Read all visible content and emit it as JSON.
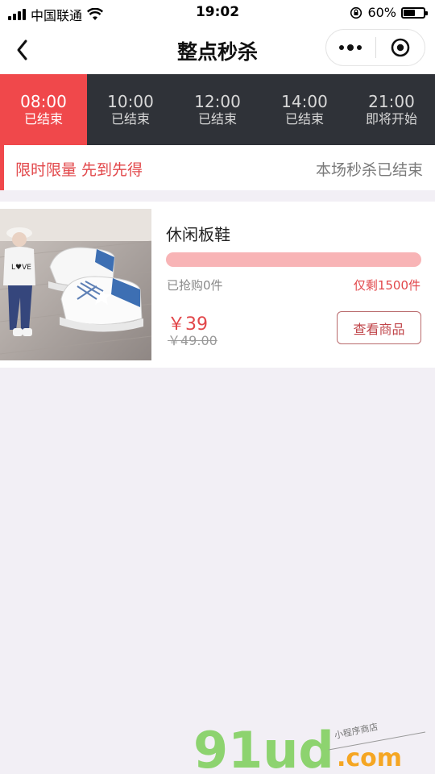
{
  "status_bar": {
    "carrier": "中国联通",
    "time": "19:02",
    "battery_percent": "60%",
    "battery_level": 0.6
  },
  "nav": {
    "title": "整点秒杀",
    "back_icon": "chevron-left-icon",
    "more_icon": "more-dots-icon",
    "close_icon": "target-close-icon"
  },
  "tabs": [
    {
      "time": "08:00",
      "status": "已结束",
      "active": true
    },
    {
      "time": "10:00",
      "status": "已结束",
      "active": false
    },
    {
      "time": "12:00",
      "status": "已结束",
      "active": false
    },
    {
      "time": "14:00",
      "status": "已结束",
      "active": false
    },
    {
      "time": "21:00",
      "status": "即将开始",
      "active": false
    }
  ],
  "info": {
    "slogan": "限时限量 先到先得",
    "session_status": "本场秒杀已结束"
  },
  "product": {
    "name": "休闲板鞋",
    "sold_text": "已抢购0件",
    "remaining_text": "仅剩1500件",
    "sold_fraction": 0,
    "price": "￥39",
    "original_price": "￥49.00",
    "button_label": "查看商品"
  },
  "watermark": {
    "brand": "91ud",
    "domain": ".com",
    "tagline": "小程序商店"
  },
  "colors": {
    "accent": "#f0484b",
    "tab_bar": "#2f3238",
    "background": "#f2eff5",
    "watermark_green": "#8dd36f",
    "watermark_orange": "#f5a623"
  }
}
